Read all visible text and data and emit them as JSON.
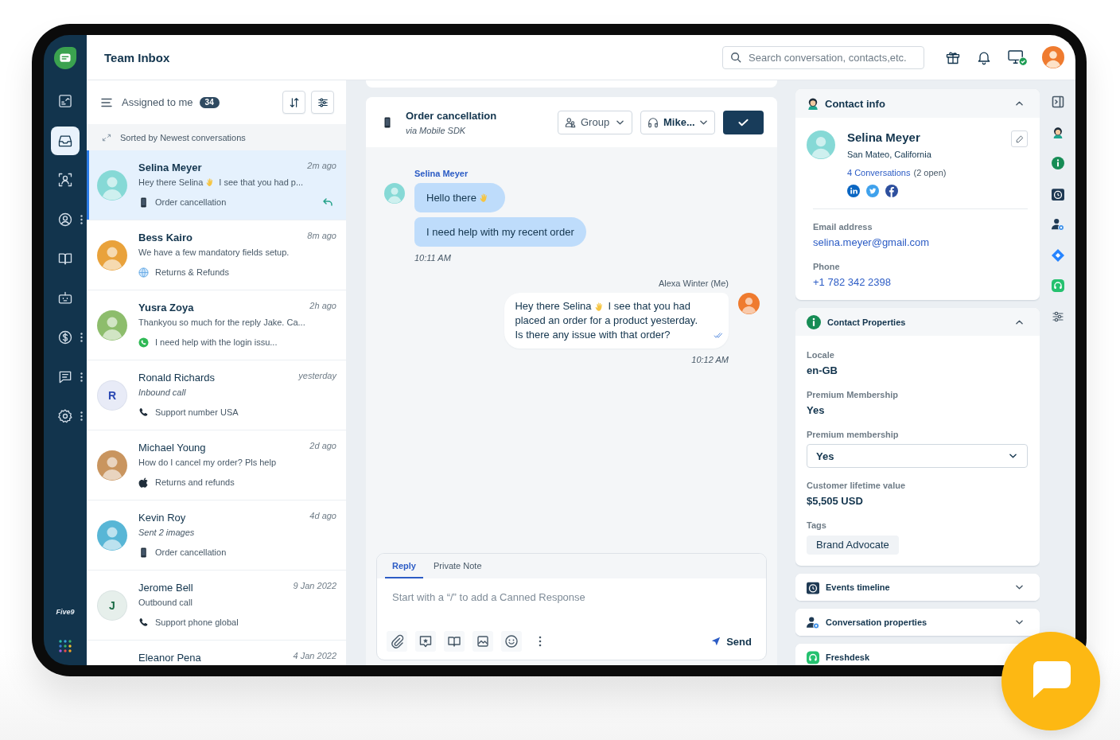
{
  "nav": {
    "items": [
      {
        "kind": "reports",
        "selected": false,
        "menu": false
      },
      {
        "kind": "inbox",
        "selected": true,
        "menu": false
      },
      {
        "kind": "contacts",
        "selected": false,
        "menu": false
      },
      {
        "kind": "profile",
        "selected": false,
        "menu": true
      },
      {
        "kind": "knowledge",
        "selected": false,
        "menu": false
      },
      {
        "kind": "bot",
        "selected": false,
        "menu": false
      },
      {
        "kind": "billing",
        "selected": false,
        "menu": true
      },
      {
        "kind": "chat",
        "selected": false,
        "menu": true
      },
      {
        "kind": "settings",
        "selected": false,
        "menu": true
      }
    ],
    "partner_logo": "Five9"
  },
  "header": {
    "title": "Team Inbox",
    "search": {
      "placeholder": "Search conversation, contacts,etc."
    }
  },
  "inbox": {
    "filter": "Assigned to me",
    "count": "34",
    "sort_note": "Sorted by Newest conversations",
    "conversations": [
      {
        "name": "Selina Meyer",
        "time": "2m ago",
        "preview": "Hey there Selina",
        "preview_emoji": true,
        "preview_after": "I see that you had p...",
        "preview_italic": false,
        "topic": {
          "kind": "mobile",
          "text": "Order cancellation"
        },
        "avatar": {
          "kind": "photo",
          "color": "#86d9d6"
        },
        "selected": true,
        "unread": true,
        "replied": true
      },
      {
        "name": "Bess Kairo",
        "time": "8m ago",
        "preview": "We have a few mandatory fields setup.",
        "preview_emoji": false,
        "preview_italic": false,
        "topic": {
          "kind": "web",
          "text": "Returns & Refunds"
        },
        "avatar": {
          "kind": "photo",
          "color": "#e9a23b"
        },
        "selected": false,
        "unread": true,
        "replied": false
      },
      {
        "name": "Yusra Zoya",
        "time": "2h ago",
        "preview": "Thankyou so much for the reply Jake. Ca...",
        "preview_emoji": false,
        "preview_italic": false,
        "topic": {
          "kind": "whatsapp",
          "text": "I need help with the login issu..."
        },
        "avatar": {
          "kind": "photo",
          "color": "#8dbd6c"
        },
        "selected": false,
        "unread": true,
        "replied": false
      },
      {
        "name": "Ronald Richards",
        "time": "yesterday",
        "preview": "Inbound call",
        "preview_emoji": false,
        "preview_italic": true,
        "topic": {
          "kind": "call",
          "text": "Support number USA"
        },
        "avatar": {
          "kind": "initial",
          "letter": "R",
          "color": "#2b49b3"
        },
        "selected": false,
        "unread": false,
        "replied": false
      },
      {
        "name": "Michael Young",
        "time": "2d ago",
        "preview": "How do I cancel my order? Pls help",
        "preview_emoji": false,
        "preview_italic": false,
        "topic": {
          "kind": "apple",
          "text": "Returns and refunds"
        },
        "avatar": {
          "kind": "photo",
          "color": "#c9955f"
        },
        "selected": false,
        "unread": false,
        "replied": false
      },
      {
        "name": "Kevin Roy",
        "time": "4d ago",
        "preview": "Sent 2 images",
        "preview_emoji": false,
        "preview_italic": true,
        "topic": {
          "kind": "mobile",
          "text": "Order cancellation"
        },
        "avatar": {
          "kind": "photo",
          "color": "#58b6d6"
        },
        "selected": false,
        "unread": false,
        "replied": false
      },
      {
        "name": "Jerome Bell",
        "time": "9 Jan 2022",
        "preview": "Outbound call",
        "preview_emoji": false,
        "preview_italic": false,
        "topic": {
          "kind": "call",
          "text": "Support phone global"
        },
        "avatar": {
          "kind": "initial",
          "letter": "J",
          "color": "#1a6b45"
        },
        "selected": false,
        "unread": false,
        "replied": false
      },
      {
        "name": "Eleanor Pena",
        "time": "4 Jan 2022",
        "selected": false,
        "unread": false
      }
    ]
  },
  "conversation": {
    "title": "Order cancellation",
    "source": {
      "kind": "mobile"
    },
    "subtitle": "via Mobile SDK",
    "group": "Group",
    "agent": "Mike...",
    "messages": [
      {
        "kind": "incoming",
        "author": "Selina Meyer",
        "avatar": {
          "color": "#86d9d6"
        },
        "bubbles": [
          {
            "text": "Hello there",
            "emoji": true
          },
          {
            "text": "I need help with my recent order",
            "emoji": false
          }
        ],
        "time": "10:11 AM",
        "read": false
      },
      {
        "kind": "outgoing",
        "author": "Alexa Winter (Me)",
        "avatar": {
          "color": "#ef7b2f"
        },
        "bubbles": [
          {
            "text": "Hey there Selina",
            "emoji": true,
            "text_after": "I see that you had",
            "more_lines": [
              "placed an order for a product yesterday.",
              "Is there any issue with that order?"
            ]
          }
        ],
        "time": "10:12 AM",
        "read": true
      }
    ],
    "composer": {
      "tabs": [
        {
          "label": "Reply",
          "selected": true
        },
        {
          "label": "Private Note",
          "selected": false
        }
      ],
      "placeholder": "Start with a “/” to add a Canned Response",
      "send": "Send"
    }
  },
  "contact_info": {
    "title": "Contact info",
    "expanded": true,
    "name": "Selina Meyer",
    "location": "San Mateo, California",
    "conversations": "4 Conversations",
    "open": "(2 open)",
    "fields": [
      {
        "label": "Email address",
        "value": "selina.meyer@gmail.com"
      },
      {
        "label": "Phone",
        "value": "+1 782 342 2398"
      }
    ]
  },
  "contact_properties": {
    "title": "Contact Properties",
    "expanded": true,
    "fields": [
      {
        "kind": "text",
        "label": "Locale",
        "value": "en-GB"
      },
      {
        "kind": "text",
        "label": "Premium Membership",
        "value": "Yes"
      },
      {
        "kind": "select",
        "label": "Premium membership",
        "value": "Yes"
      },
      {
        "kind": "text",
        "label": "Customer lifetime value",
        "value": "$5,505 USD"
      },
      {
        "kind": "tags",
        "label": "Tags",
        "tags": [
          "Brand Advocate"
        ]
      }
    ]
  },
  "sections": [
    {
      "kind": "events",
      "title": "Events timeline",
      "expanded": false
    },
    {
      "kind": "conversation",
      "title": "Conversation properties",
      "expanded": false
    },
    {
      "kind": "freshdesk",
      "title": "Freshdesk"
    }
  ]
}
